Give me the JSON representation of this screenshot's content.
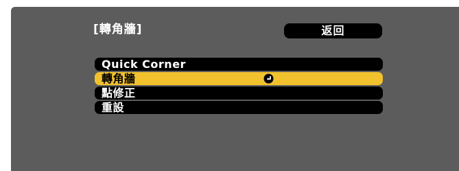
{
  "menu": {
    "title": "[轉角牆]",
    "back_label": "返回",
    "items": [
      {
        "label": "Quick Corner"
      },
      {
        "label": "轉角牆"
      },
      {
        "label": "點修正"
      },
      {
        "label": "重設"
      }
    ],
    "selected_index": 1,
    "selected_icon": "enter-icon",
    "colors": {
      "background": "#5c5c5c",
      "item_background": "#000000",
      "selected_background": "#f2c12e",
      "text": "#ffffff",
      "selected_text": "#000000"
    }
  }
}
